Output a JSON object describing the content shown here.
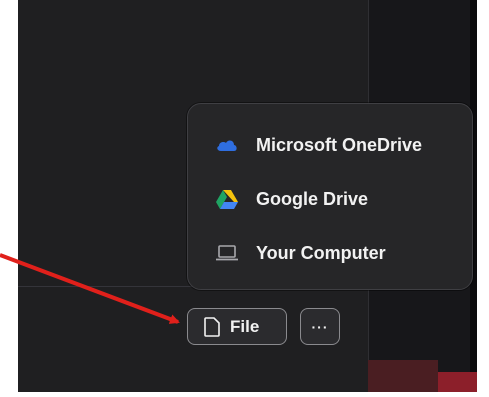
{
  "upload_menu": {
    "items": [
      {
        "label": "Microsoft OneDrive",
        "icon": "onedrive-cloud-icon"
      },
      {
        "label": "Google Drive",
        "icon": "google-drive-icon"
      },
      {
        "label": "Your Computer",
        "icon": "laptop-icon"
      }
    ]
  },
  "toolbar": {
    "file_label": "File",
    "more_label": "···"
  },
  "colors": {
    "accent_arrow": "#e0201b",
    "onedrive_blue": "#2f6ee0",
    "background": "#1f1f21",
    "popup_bg": "#262628"
  }
}
